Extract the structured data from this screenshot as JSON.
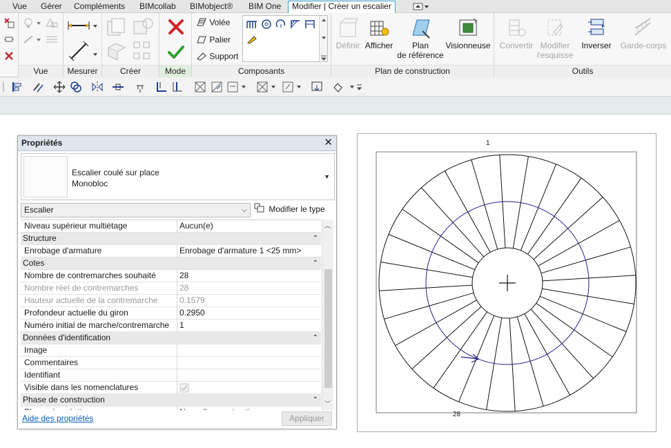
{
  "menu": {
    "tabs": [
      "Vue",
      "Gérer",
      "Compléments",
      "BIMcollab",
      "BIMobject®",
      "BIM One",
      "Modifier | Créer un escalier"
    ],
    "active_tab": "Modifier | Créer un escalier"
  },
  "ribbon": {
    "panels": {
      "vue": "Vue",
      "mesurer": "Mesurer",
      "creer": "Créer",
      "mode": "Mode",
      "composants": "Composants",
      "plan_construction": "Plan de construction",
      "outils": "Outils"
    },
    "composants": {
      "volee": "Volée",
      "palier": "Palier",
      "support": "Support"
    },
    "plan_construction": {
      "definir": "Définir",
      "afficher": "Afficher",
      "plan_l1": "Plan",
      "plan_l2": "de référence",
      "visionneuse": "Visionneuse"
    },
    "outils": {
      "convertir": "Convertir",
      "modifier_l1": "Modifier",
      "modifier_l2": "l'esquisse",
      "inverser": "Inverser",
      "garde_corps": "Garde-corps"
    }
  },
  "properties": {
    "title": "Propriétés",
    "type_line1": "Escalier coulé sur place",
    "type_line2": "Monobloc",
    "family": "Escalier",
    "edit_type": "Modifier le type",
    "rows": [
      {
        "kind": "prop",
        "key": "Niveau supérieur multiétage",
        "value": "Aucun(e)",
        "dim": false
      },
      {
        "kind": "group",
        "key": "Structure"
      },
      {
        "kind": "prop",
        "key": "Enrobage d'armature",
        "value": "Enrobage d'armature 1 <25 mm>",
        "dim": false
      },
      {
        "kind": "group",
        "key": "Cotes"
      },
      {
        "kind": "prop",
        "key": "Nombre de contremarches souhaité",
        "value": "28",
        "dim": false
      },
      {
        "kind": "prop",
        "key": "Nombre réel de contremarches",
        "value": "28",
        "dim": true
      },
      {
        "kind": "prop",
        "key": "Hauteur actuelle de la contremarche",
        "value": "0.1579",
        "dim": true
      },
      {
        "kind": "prop",
        "key": "Profondeur actuelle du giron",
        "value": "0.2950",
        "dim": false
      },
      {
        "kind": "prop",
        "key": "Numéro initial de marche/contremarche",
        "value": "1",
        "dim": false
      },
      {
        "kind": "group",
        "key": "Données d'identification"
      },
      {
        "kind": "prop",
        "key": "Image",
        "value": "",
        "dim": false
      },
      {
        "kind": "prop",
        "key": "Commentaires",
        "value": "",
        "dim": false
      },
      {
        "kind": "prop",
        "key": "Identifiant",
        "value": "",
        "dim": false
      },
      {
        "kind": "check",
        "key": "Visible dans les nomenclatures",
        "value": "",
        "dim": false
      },
      {
        "kind": "group",
        "key": "Phase de construction"
      },
      {
        "kind": "prop",
        "key": "Phase de création",
        "value": "Nouvelle construction",
        "dim": false
      }
    ],
    "help_link": "Aide des propriétés",
    "apply": "Appliquer"
  },
  "drawing": {
    "label_first": "1",
    "label_last": "28",
    "risers": 28
  },
  "colors": {
    "accent": "#37a5d6",
    "path": "#1f1f8c",
    "disabled": "#a6a6a6"
  }
}
